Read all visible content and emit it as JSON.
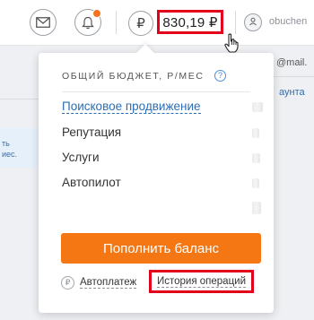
{
  "header": {
    "balance": "830,19 ₽",
    "username": "obuchen",
    "currency_symbol": "₽"
  },
  "background": {
    "email_fragment": "@mail.",
    "link_fragment": "аунта",
    "card_line1": "ть",
    "card_line2": "иес."
  },
  "dropdown": {
    "header": "ОБЩИЙ БЮДЖЕТ, Р/МЕС",
    "help_symbol": "?",
    "items": [
      {
        "label": "Поисковое продвижение"
      },
      {
        "label": "Репутация"
      },
      {
        "label": "Услуги"
      },
      {
        "label": "Автопилот"
      }
    ],
    "topup_button": "Пополнить баланс",
    "autopay_label": "Автоплатеж",
    "autopay_icon_text": "₽",
    "history_label": "История операций"
  },
  "colors": {
    "accent_orange": "#f47714",
    "highlight_red": "#e3001b",
    "link_blue": "#2d6db4",
    "notification_dot": "#f5731f"
  },
  "icons": [
    "mail-icon",
    "bell-icon",
    "ruble-icon",
    "user-icon",
    "cursor-hand-icon",
    "help-icon"
  ]
}
